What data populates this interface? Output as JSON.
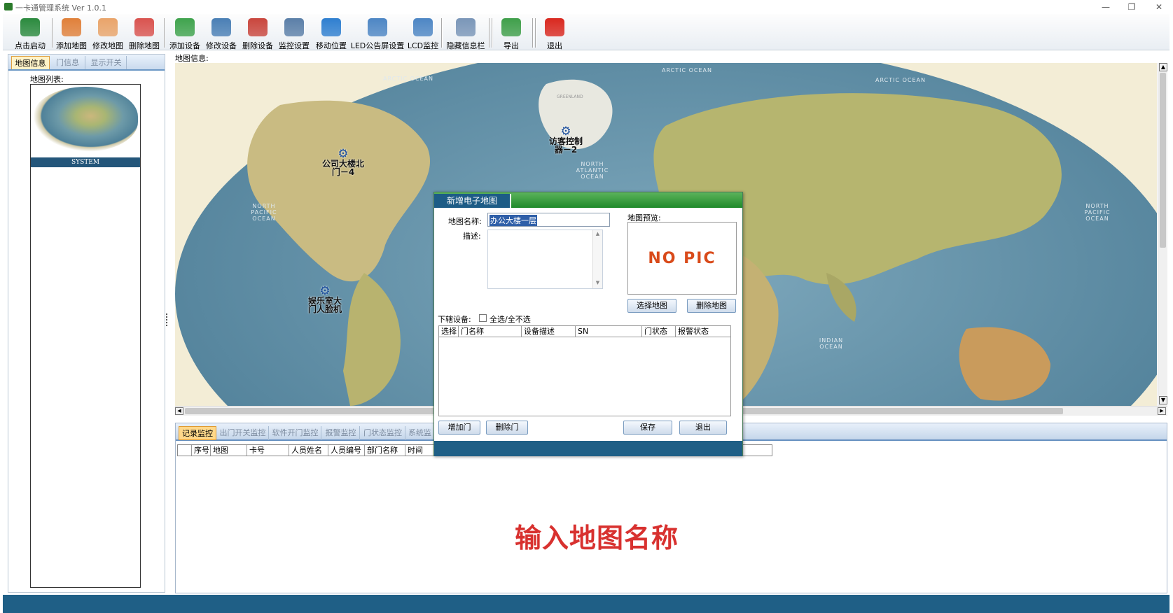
{
  "window": {
    "title": "一卡通管理系统  Ver 1.0.1",
    "minimize": "—",
    "restore": "❐",
    "close": "✕"
  },
  "toolbar": [
    {
      "label": "点击启动",
      "icon": "start-icon",
      "color": "#2b8a3e"
    },
    {
      "label": "添加地图",
      "icon": "add-map-icon",
      "color": "#e0803a"
    },
    {
      "label": "修改地图",
      "icon": "edit-map-icon",
      "color": "#e9a46a"
    },
    {
      "label": "删除地图",
      "icon": "delete-map-icon",
      "color": "#d9534f"
    },
    {
      "label": "添加设备",
      "icon": "add-device-icon",
      "color": "#3fa34d"
    },
    {
      "label": "修改设备",
      "icon": "edit-device-icon",
      "color": "#4a7fb5"
    },
    {
      "label": "删除设备",
      "icon": "delete-device-icon",
      "color": "#c9463d"
    },
    {
      "label": "监控设置",
      "icon": "monitor-settings-icon",
      "color": "#5b7fa8"
    },
    {
      "label": "移动位置",
      "icon": "move-icon",
      "color": "#2f7fd0"
    },
    {
      "label": "LED公告屏设置",
      "icon": "led-icon",
      "color": "#4d86c4"
    },
    {
      "label": "LCD监控",
      "icon": "lcd-icon",
      "color": "#4d86c4"
    },
    {
      "label": "隐藏信息栏",
      "icon": "hide-panel-icon",
      "color": "#7a96b8"
    },
    {
      "label": "导出",
      "icon": "export-icon",
      "color": "#3f9f4a"
    },
    {
      "label": "退出",
      "icon": "power-icon",
      "color": "#d9281f"
    }
  ],
  "left": {
    "tabs": [
      "地图信息",
      "门信息",
      "显示开关"
    ],
    "list_label": "地图列表:",
    "thumb_caption": "SYSTEM"
  },
  "map": {
    "label": "地图信息:",
    "ocean_labels": [
      "ARCTIC OCEAN",
      "ARCTIC OCEAN",
      "ARCTIC OCEAN",
      "NORTH ATLANTIC OCEAN",
      "NORTH PACIFIC OCEAN",
      "NORTH PACIFIC OCEAN",
      "INDIAN OCEAN",
      "GREENLAND"
    ],
    "devices": [
      {
        "name": "公司大楼北门－4"
      },
      {
        "name": "访客控制器－2"
      },
      {
        "name": "娱乐室大门人脸机"
      }
    ]
  },
  "bottom": {
    "tabs": [
      "记录监控",
      "出门开关监控",
      "软件开门监控",
      "报警监控",
      "门状态监控",
      "系统监"
    ],
    "columns": [
      "序号",
      "地图",
      "卡号",
      "人员姓名",
      "人员编号",
      "部门名称",
      "时间"
    ]
  },
  "dialog": {
    "tab": "新增电子地图",
    "name_label": "地图名称:",
    "name_value": "办公大楼一层",
    "desc_label": "描述:",
    "preview_label": "地图预览:",
    "no_pic": "NO PIC",
    "select_map": "选择地图",
    "delete_map": "删除地图",
    "devices_label": "下辖设备:",
    "select_all": "全选/全不选",
    "columns": [
      "选择",
      "门名称",
      "设备描述",
      "SN",
      "门状态",
      "报警状态"
    ],
    "add_door": "增加门",
    "delete_door": "删除门",
    "save": "保存",
    "exit": "退出"
  },
  "caption": "输入地图名称"
}
